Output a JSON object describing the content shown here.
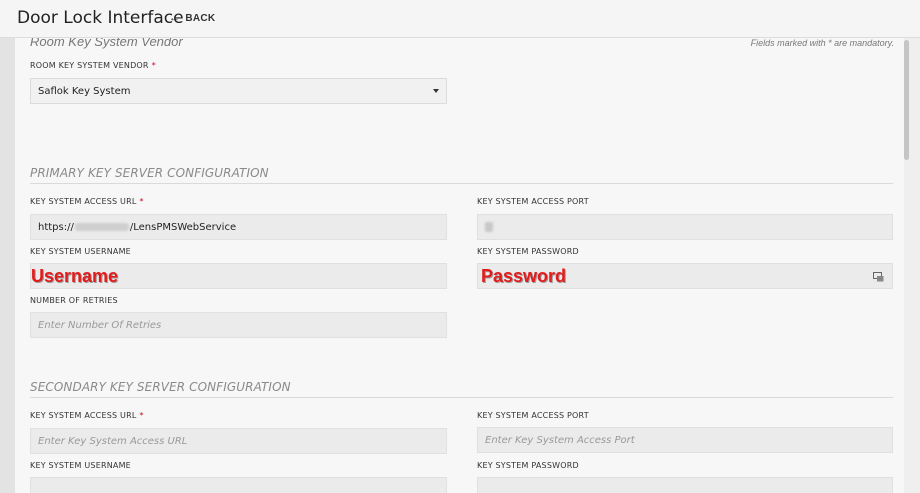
{
  "header": {
    "title": "Door Lock Interface",
    "back_label": "BACK"
  },
  "top_section": {
    "heading": "Room Key System Vendor",
    "mandatory_note": "Fields marked with * are mandatory."
  },
  "vendor": {
    "label": "ROOM KEY SYSTEM VENDOR",
    "value": "Saflok Key System"
  },
  "primary": {
    "title": "PRIMARY KEY SERVER CONFIGURATION",
    "url_label": "KEY SYSTEM ACCESS URL",
    "url_prefix": "https://",
    "url_suffix": "/LensPMSWebService",
    "port_label": "KEY SYSTEM ACCESS PORT",
    "username_label": "KEY SYSTEM USERNAME",
    "username_value": "Username",
    "password_label": "KEY SYSTEM PASSWORD",
    "password_value": "Password",
    "retries_label": "NUMBER OF RETRIES",
    "retries_placeholder": "Enter Number Of Retries"
  },
  "secondary": {
    "title": "SECONDARY KEY SERVER CONFIGURATION",
    "url_label": "KEY SYSTEM ACCESS URL",
    "url_placeholder": "Enter Key System Access URL",
    "port_label": "KEY SYSTEM ACCESS PORT",
    "port_placeholder": "Enter Key System Access Port",
    "username_label": "KEY SYSTEM USERNAME",
    "password_label": "KEY SYSTEM PASSWORD"
  },
  "required_marker": "*"
}
